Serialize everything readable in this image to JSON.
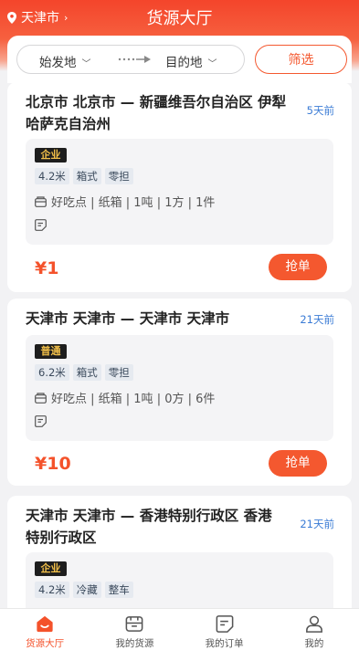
{
  "header": {
    "location": "天津市",
    "title": "货源大厅"
  },
  "filter": {
    "origin": "始发地",
    "destination": "目的地",
    "filter_label": "筛选"
  },
  "orders": [
    {
      "route_line1": "北京市 北京市 — 新疆维吾尔自治区 伊犁",
      "route_line2": "哈萨克自治州",
      "time_ago": "5天前",
      "badge": "企业",
      "chips": [
        "4.2米",
        "箱式",
        "零担"
      ],
      "cargo": "好吃点 | 纸箱 | 1吨 | 1方 | 1件",
      "price": "¥1",
      "action": "抢单"
    },
    {
      "route_line1": "天津市 天津市 — 天津市 天津市",
      "route_line2": "",
      "time_ago": "21天前",
      "badge": "普通",
      "chips": [
        "6.2米",
        "箱式",
        "零担"
      ],
      "cargo": "好吃点 | 纸箱 | 1吨 | 0方 | 6件",
      "price": "¥10",
      "action": "抢单"
    },
    {
      "route_line1": "天津市 天津市 — 香港特别行政区 香港",
      "route_line2": "特别行政区",
      "time_ago": "21天前",
      "badge": "企业",
      "chips": [
        "4.2米",
        "冷藏",
        "整车"
      ]
    }
  ],
  "tabbar": {
    "items": [
      {
        "label": "货源大厅",
        "icon": "home-icon"
      },
      {
        "label": "我的货源",
        "icon": "cargo-box-icon"
      },
      {
        "label": "我的订单",
        "icon": "order-icon"
      },
      {
        "label": "我的",
        "icon": "user-icon"
      }
    ],
    "active_color": "#f4522b"
  },
  "colors": {
    "accent": "#f4582f",
    "time_blue": "#3a7bd5",
    "badge_gold": "#f5c24a"
  }
}
